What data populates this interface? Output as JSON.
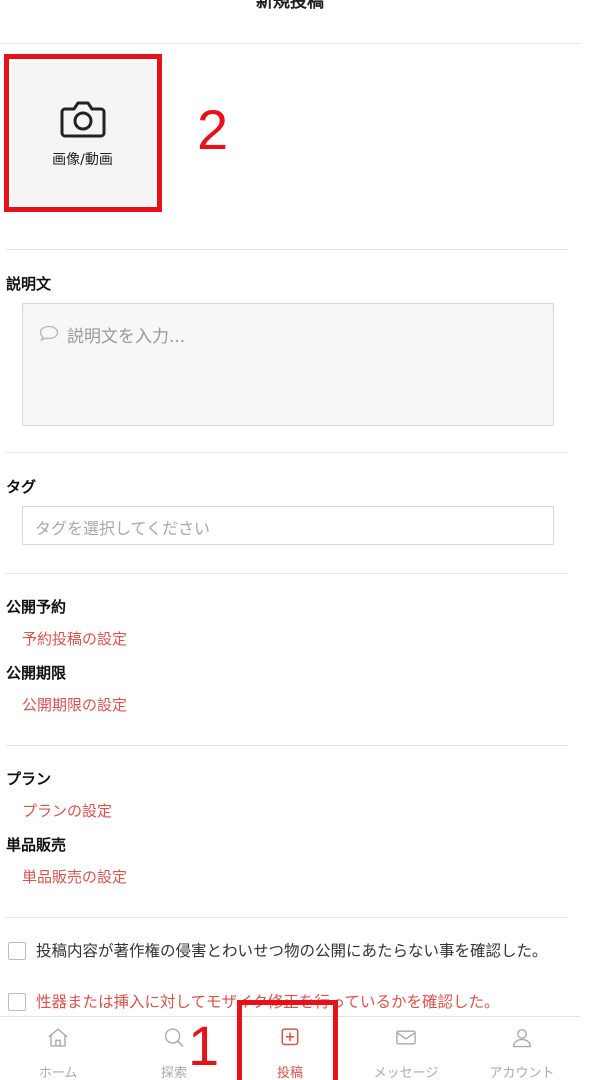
{
  "header": {
    "title": "新規投稿"
  },
  "media": {
    "label": "画像/動画"
  },
  "annotations": {
    "one": "1",
    "two": "2"
  },
  "description": {
    "label": "説明文",
    "placeholder": "説明文を入力..."
  },
  "tags": {
    "label": "タグ",
    "placeholder": "タグを選択してください"
  },
  "schedule": {
    "label": "公開予約",
    "link": "予約投稿の設定"
  },
  "expiry": {
    "label": "公開期限",
    "link": "公開期限の設定"
  },
  "plan": {
    "label": "プラン",
    "link": "プランの設定"
  },
  "single_sale": {
    "label": "単品販売",
    "link": "単品販売の設定"
  },
  "confirmations": [
    {
      "text": "投稿内容が著作権の侵害とわいせつ物の公開にあたらない事を確認した。"
    },
    {
      "text": "性器または挿入に対してモザイク修正を行っているかを確認した。"
    }
  ],
  "tabbar": {
    "items": [
      {
        "label": "ホーム",
        "icon": "home-icon"
      },
      {
        "label": "探索",
        "icon": "search-icon"
      },
      {
        "label": "投稿",
        "icon": "post-icon"
      },
      {
        "label": "メッセージ",
        "icon": "mail-icon"
      },
      {
        "label": "アカウント",
        "icon": "user-icon"
      }
    ],
    "active_index": 2
  },
  "colors": {
    "accent": "#d9534f",
    "annotation": "#e8111a"
  }
}
